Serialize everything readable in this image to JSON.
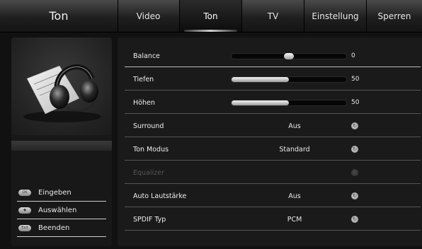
{
  "header": {
    "title": "Ton",
    "tabs": [
      {
        "label": "Video"
      },
      {
        "label": "Ton"
      },
      {
        "label": "TV"
      },
      {
        "label": "Einstellung"
      },
      {
        "label": "Sperren"
      }
    ],
    "active_tab": "Ton"
  },
  "sidebar": {
    "hints": [
      {
        "key": "OK",
        "label": "Eingeben"
      },
      {
        "key": "◆",
        "label": "Auswählen"
      },
      {
        "key": "Exit",
        "label": "Beenden"
      }
    ]
  },
  "settings": {
    "balance": {
      "label": "Balance",
      "value": "0",
      "level": 0.5
    },
    "tiefen": {
      "label": "Tiefen",
      "value": "50",
      "level": 0.5
    },
    "hoehen": {
      "label": "Höhen",
      "value": "50",
      "level": 0.5
    },
    "surround": {
      "label": "Surround",
      "value": "Aus"
    },
    "ton_modus": {
      "label": "Ton Modus",
      "value": "Standard"
    },
    "equalizer": {
      "label": "Equalizer",
      "value": ""
    },
    "auto_lautstaerke": {
      "label": "Auto Lautstärke",
      "value": "Aus"
    },
    "spdif_typ": {
      "label": "SPDIF Typ",
      "value": "PCM"
    }
  },
  "colors": {
    "background": "#111111",
    "panel": "#1a1a1a",
    "text": "#f0f0f0",
    "disabled": "#555555"
  },
  "icons": {
    "cycle": "cycle-icon",
    "headphones": "headphones-icon"
  }
}
